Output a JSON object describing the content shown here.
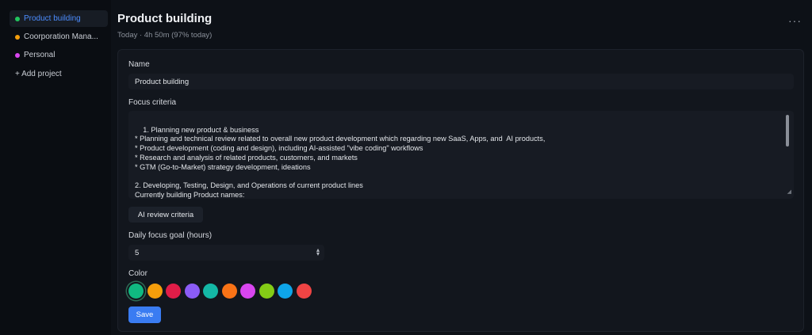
{
  "sidebar": {
    "items": [
      {
        "label": "Product building",
        "color": "#22c55e"
      },
      {
        "label": "Coorporation Mana...",
        "color": "#f59e0b"
      },
      {
        "label": "Personal",
        "color": "#d946ef"
      }
    ],
    "add_project": "+ Add project"
  },
  "header": {
    "title": "Product building",
    "subtitle": "Today · 4h 50m (97% today)",
    "more": "···"
  },
  "form": {
    "name_label": "Name",
    "name_value": "Product building",
    "focus_label": "Focus criteria",
    "focus_text": "1. Planning new product & business\n* Planning and technical review related to overall new product development which regarding new SaaS, Apps, and  AI products,\n* Product development (coding and design), including AI-assisted \"vibe coding\" workflows\n* Research and analysis of related products, customers, and markets\n* GTM (Go-to-Market) strategy development, ideations\n\n2. Developing, Testing, Design, and Operations of current product lines\nCurrently building Product names:\n* Kloy - Time and focus tracking based on user screen activity, Mac app (previous FocusLens)",
    "ai_review_button": "AI review criteria",
    "goal_label": "Daily focus goal (hours)",
    "goal_value": "5",
    "color_label": "Color",
    "colors": [
      "#10b981",
      "#f59e0b",
      "#e11d48",
      "#8b5cf6",
      "#14b8a6",
      "#f97316",
      "#d946ef",
      "#84cc16",
      "#0ea5e9",
      "#ef4444"
    ],
    "selected_color_index": 0,
    "save_button": "Save"
  }
}
